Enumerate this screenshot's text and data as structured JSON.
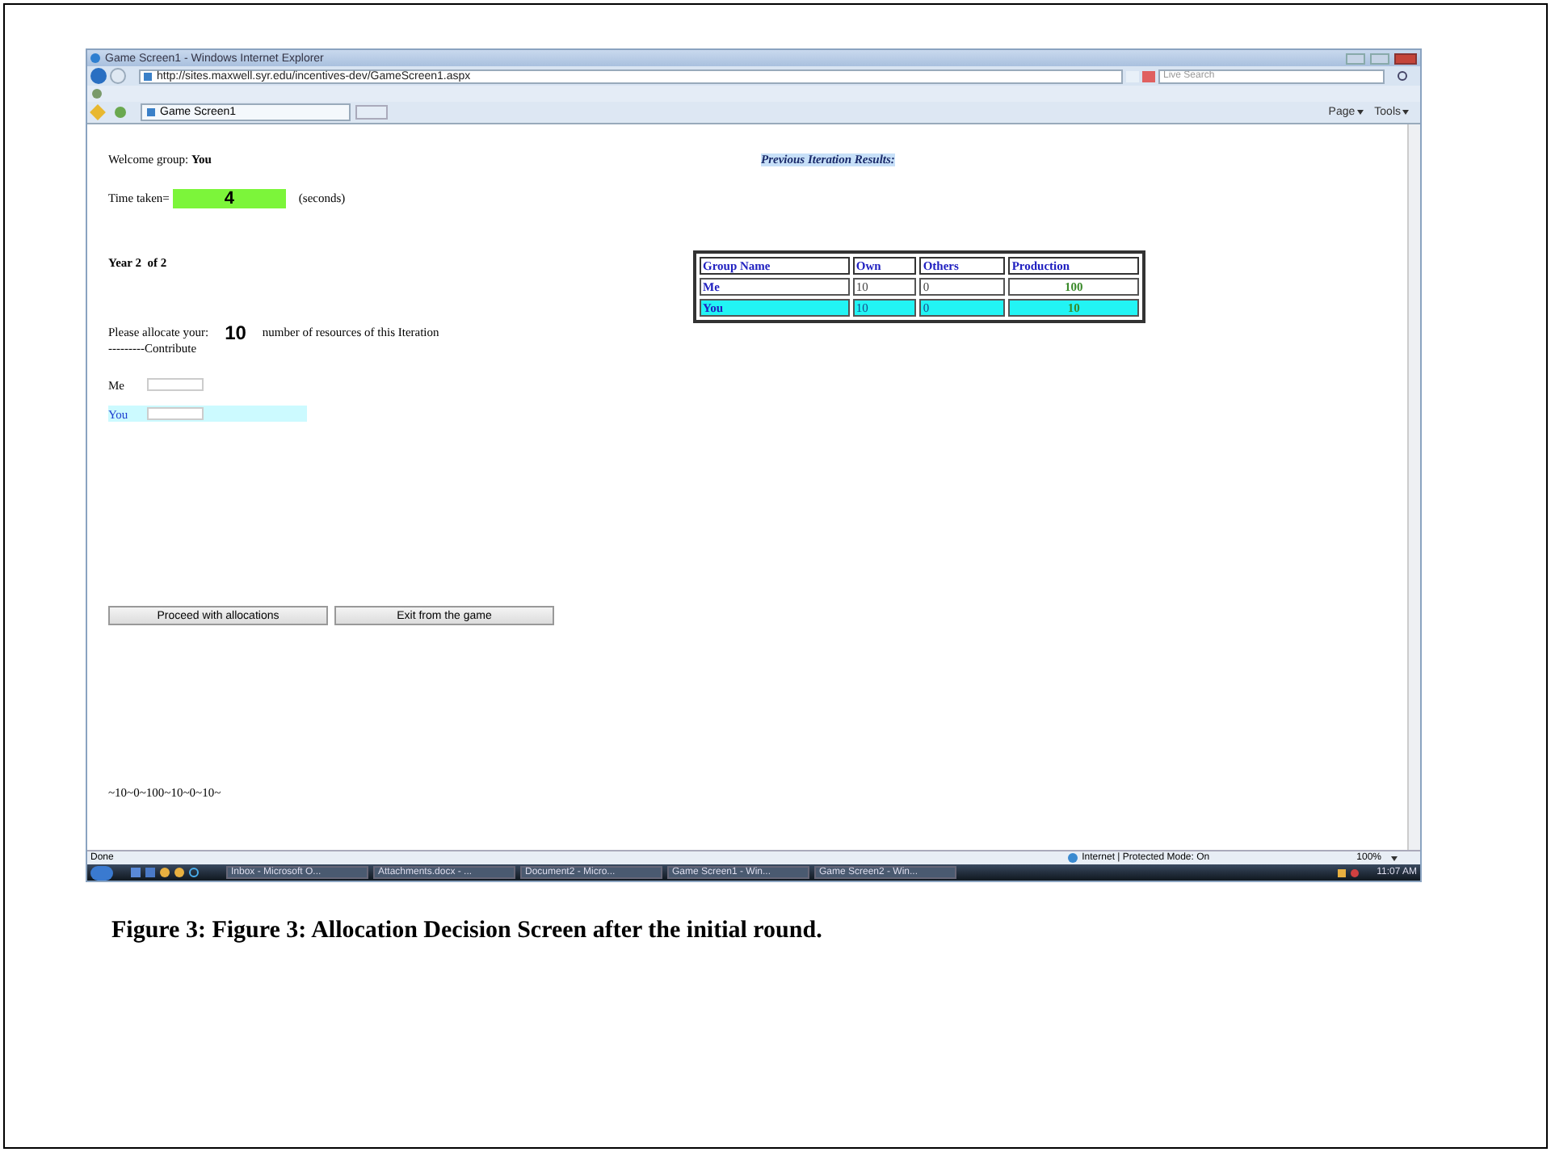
{
  "browser": {
    "title": "Game Screen1 - Windows Internet Explorer",
    "url": "http://sites.maxwell.syr.edu/incentives-dev/GameScreen1.aspx",
    "search": {
      "placeholder": "Live Search"
    },
    "tab": {
      "label": "Game Screen1",
      "selected": true
    },
    "toolbar": [
      "Page",
      "Tools"
    ]
  },
  "page": {
    "welcome": "Welcome group: **You**",
    "time_label": "Time taken=",
    "time_value": "4",
    "time_unit": "(seconds)",
    "year": "Year 2  of 2",
    "allocate_prefix": "Please allocate your:",
    "allocate_value": "10",
    "allocate_suffix": "number of resources of this Iteration",
    "contribute": "---------Contribute",
    "fields": [
      {
        "label": "Me",
        "highlighted": false
      },
      {
        "label": "You",
        "highlighted": true
      }
    ],
    "buttons": [
      "Proceed with allocations",
      "Exit from the game"
    ],
    "footer": "~10~0~100~10~0~10~",
    "results_title": "Previous Iteration Results:",
    "table": {
      "columns": [
        "Group Name",
        "Own",
        "Others",
        "Production"
      ],
      "rows": [
        {
          "cells": [
            "Me",
            "10",
            "0",
            "100"
          ],
          "highlighted": false
        },
        {
          "cells": [
            "You",
            "10",
            "0",
            "10"
          ],
          "highlighted": true
        }
      ]
    }
  },
  "status_bar": {
    "text": "Done",
    "zone": "Internet | Protected Mode: On",
    "zoom": "100%"
  },
  "taskbar": {
    "items": [
      "Inbox - Microsoft O...",
      "Attachments.docx - ...",
      "Document2 - Micro...",
      "Game Screen1 - Win...",
      "Game Screen2 - Win..."
    ],
    "clock": "11:07 AM"
  },
  "caption": "Figure 3:  Figure 3: Allocation Decision Screen after the initial round."
}
